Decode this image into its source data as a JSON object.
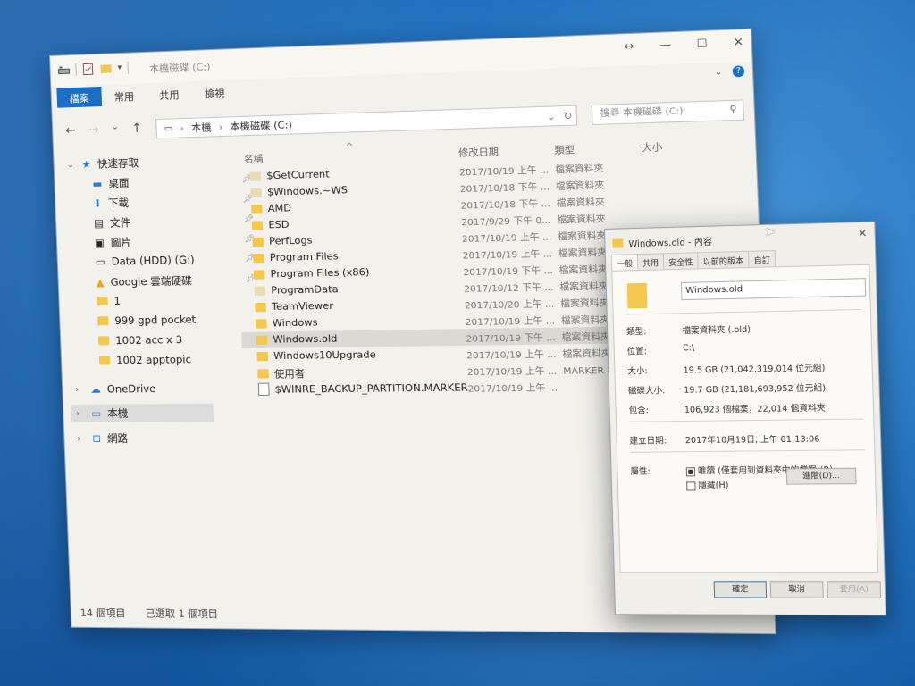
{
  "explorer": {
    "title": "本機磁碟 (C:)",
    "ribbon_tabs": [
      "檔案",
      "常用",
      "共用",
      "檢視"
    ],
    "address": [
      "本機",
      "本機磁碟 (C:)"
    ],
    "search_placeholder": "搜尋 本機磁碟 (C:)",
    "columns": [
      "名稱",
      "修改日期",
      "類型",
      "大小"
    ],
    "nav": {
      "quick_access": "快速存取",
      "items": [
        "桌面",
        "下載",
        "文件",
        "圖片",
        "Data (HDD) (G:)",
        "Google 雲端硬碟",
        "1",
        "999 gpd pocket",
        "1002 acc x 3",
        "1002 apptopic"
      ],
      "onedrive": "OneDrive",
      "this_pc": "本機",
      "network": "網路"
    },
    "files": [
      {
        "name": "$GetCurrent",
        "date": "2017/10/19 上午 ...",
        "type": "檔案資料夾"
      },
      {
        "name": "$Windows.~WS",
        "date": "2017/10/18 下午 ...",
        "type": "檔案資料夾"
      },
      {
        "name": "AMD",
        "date": "2017/10/18 下午 ...",
        "type": "檔案資料夾"
      },
      {
        "name": "ESD",
        "date": "2017/9/29 下午 0...",
        "type": "檔案資料夾"
      },
      {
        "name": "PerfLogs",
        "date": "2017/10/19 上午 ...",
        "type": "檔案資料夾"
      },
      {
        "name": "Program Files",
        "date": "2017/10/19 上午 ...",
        "type": "檔案資料夾"
      },
      {
        "name": "Program Files (x86)",
        "date": "2017/10/19 下午 ...",
        "type": "檔案資料夾"
      },
      {
        "name": "ProgramData",
        "date": "2017/10/12 下午 ...",
        "type": "檔案資料夾"
      },
      {
        "name": "TeamViewer",
        "date": "2017/10/20 上午 ...",
        "type": "檔案資料夾"
      },
      {
        "name": "Windows",
        "date": "2017/10/19 上午 ...",
        "type": "檔案資料夾"
      },
      {
        "name": "Windows.old",
        "date": "2017/10/19 下午 ...",
        "type": "檔案資料夾"
      },
      {
        "name": "Windows10Upgrade",
        "date": "2017/10/19 上午 ...",
        "type": "檔案資料夾"
      },
      {
        "name": "使用者",
        "date": "2017/10/19 上午 ...",
        "type": "MARKER 檔案"
      },
      {
        "name": "$WINRE_BACKUP_PARTITION.MARKER",
        "date": "2017/10/19 上午 ...",
        "type": ""
      }
    ],
    "status": {
      "count": "14 個項目",
      "selected": "已選取 1 個項目"
    }
  },
  "props": {
    "title": "Windows.old - 內容",
    "tabs": [
      "一般",
      "共用",
      "安全性",
      "以前的版本",
      "自訂"
    ],
    "name": "Windows.old",
    "rows": {
      "type_label": "類型:",
      "type_value": "檔案資料夾 (.old)",
      "location_label": "位置:",
      "location_value": "C:\\",
      "size_label": "大小:",
      "size_value": "19.5 GB (21,042,319,014 位元組)",
      "disk_label": "磁碟大小:",
      "disk_value": "19.7 GB (21,181,693,952 位元組)",
      "contains_label": "包含:",
      "contains_value": "106,923 個檔案，22,014 個資料夾",
      "created_label": "建立日期:",
      "created_value": "2017年10月19日, 上午 01:13:06",
      "attr_label": "屬性:",
      "readonly": "唯讀 (僅套用到資料夾中的檔案)(R)",
      "hidden": "隱藏(H)",
      "advanced": "進階(D)..."
    },
    "buttons": [
      "確定",
      "取消",
      "套用(A)"
    ]
  }
}
